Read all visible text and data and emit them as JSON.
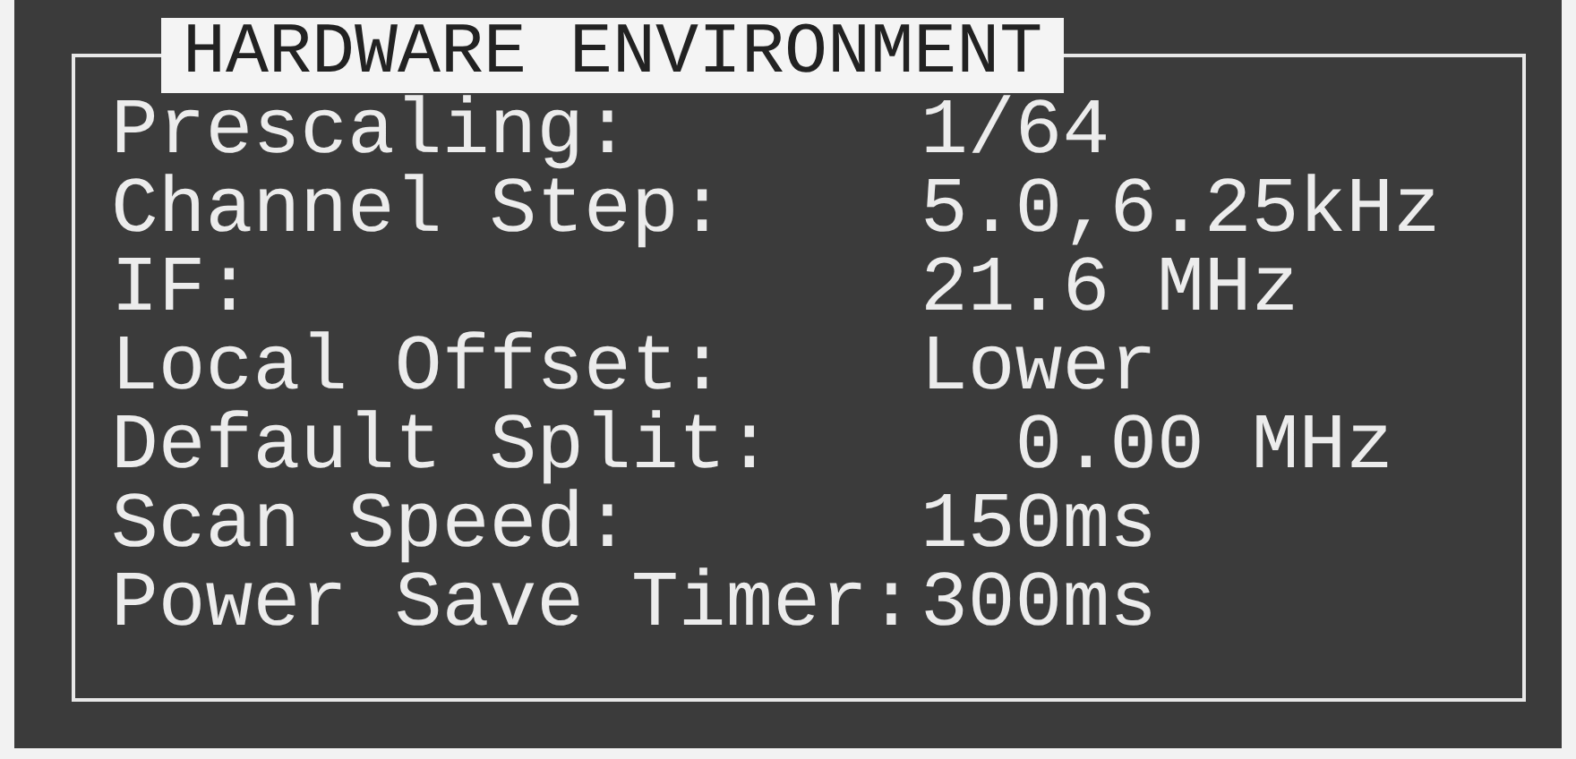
{
  "title": "HARDWARE ENVIRONMENT",
  "rows": [
    {
      "label": "Prescaling:",
      "value": "1/64"
    },
    {
      "label": "Channel Step:",
      "value": "5.0,6.25kHz"
    },
    {
      "label": "IF:",
      "value": "21.6 MHz"
    },
    {
      "label": "Local Offset:",
      "value": "Lower"
    },
    {
      "label": "Default Split:",
      "value": "  0.00 MHz"
    },
    {
      "label": "Scan Speed:",
      "value": "150ms"
    },
    {
      "label": "Power Save Timer:",
      "value": "300ms"
    }
  ]
}
